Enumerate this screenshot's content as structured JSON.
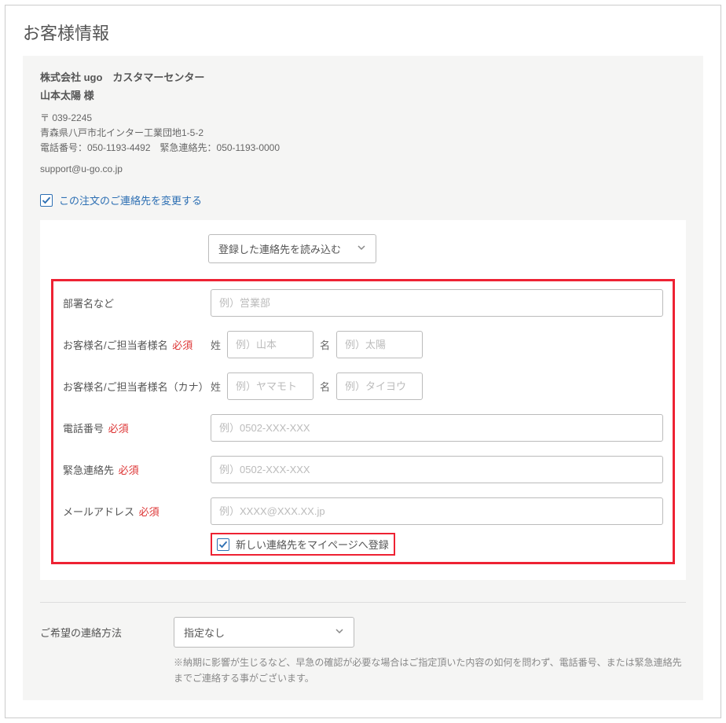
{
  "page_title": "お客様情報",
  "customer": {
    "company": "株式会社 ugo　カスタマーセンター",
    "person": "山本太陽 様",
    "postal": "〒 039-2245",
    "address": "青森県八戸市北インター工業団地1-5-2",
    "phone_line": "電話番号：050-1193-4492　緊急連絡先：050-1193-0000",
    "email": "support@u-go.co.jp"
  },
  "change_contact_label": "この注文のご連絡先を変更する",
  "load_contacts_label": "登録した連絡先を読み込む",
  "required_label": "必須",
  "labels": {
    "department": "部署名など",
    "customer_name": "お客様名/ご担当者様名",
    "customer_name_kana": "お客様名/ご担当者様名（カナ）",
    "phone": "電話番号",
    "emergency": "緊急連絡先",
    "mail": "メールアドレス",
    "sei": "姓",
    "mei": "名"
  },
  "placeholders": {
    "department": "例）営業部",
    "sei": "例）山本",
    "mei": "例）太陽",
    "sei_kana": "例）ヤマモト",
    "mei_kana": "例）タイヨウ",
    "phone": "例）0502-XXX-XXX",
    "emergency": "例）0502-XXX-XXX",
    "mail": "例）XXXX@XXX.XX.jp"
  },
  "save_mypage_label": "新しい連絡先をマイページへ登録",
  "preferred_contact_label": "ご希望の連絡方法",
  "preferred_contact_value": "指定なし",
  "note_text": "※納期に影響が生じるなど、早急の確認が必要な場合はご指定頂いた内容の如何を問わず、電話番号、または緊急連絡先までご連絡する事がございます。"
}
